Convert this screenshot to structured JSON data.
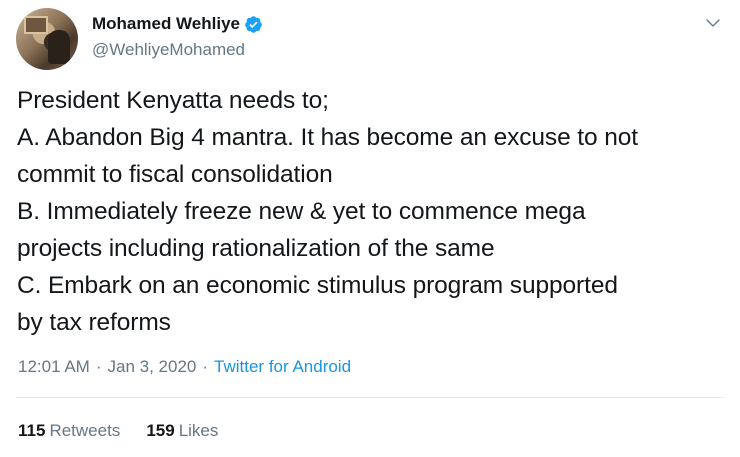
{
  "tweet": {
    "author": {
      "display_name": "Mohamed Wehliye",
      "handle": "@WehliyeMohamed",
      "verified_icon": "verified-badge-icon"
    },
    "menu_icon": "chevron-down-icon",
    "text_lines": [
      "President Kenyatta needs to;",
      "A. Abandon Big 4 mantra. It has become an excuse to not",
      "commit to fiscal consolidation",
      "B. Immediately freeze new & yet to commence mega",
      "projects including rationalization of the same",
      "C. Embark on an economic stimulus program supported",
      "by tax reforms"
    ],
    "meta": {
      "time": "12:01 AM",
      "separator": "·",
      "date": "Jan 3, 2020",
      "source": "Twitter for Android"
    },
    "stats": {
      "retweets_count": "115",
      "retweets_label": "Retweets",
      "likes_count": "159",
      "likes_label": "Likes"
    },
    "colors": {
      "text": "#14171a",
      "secondary": "#657786",
      "link": "#1b95e0",
      "verified": "#1da1f2",
      "divider": "#e6ecf0"
    }
  }
}
